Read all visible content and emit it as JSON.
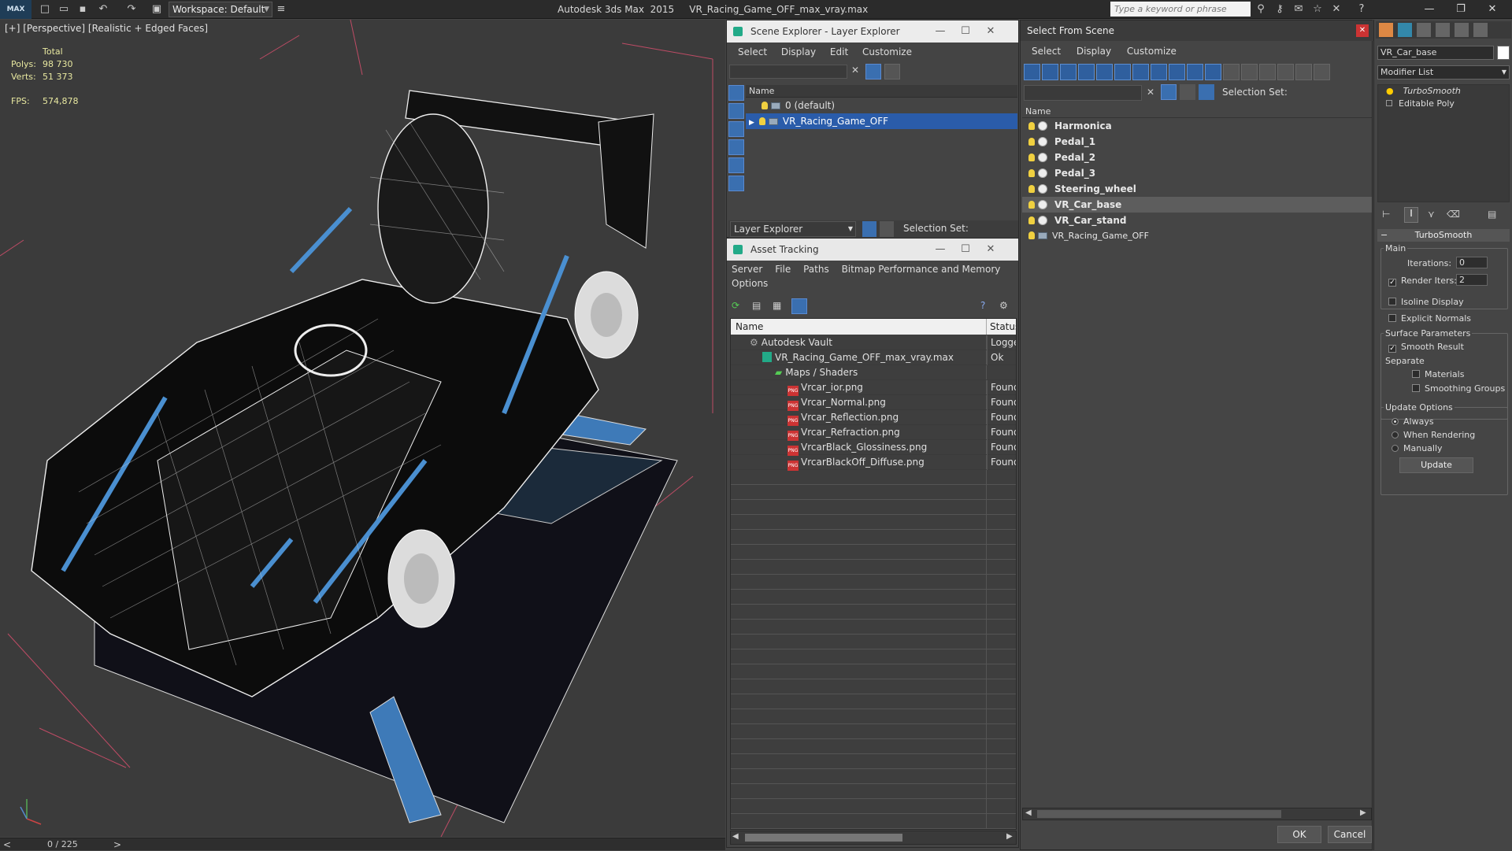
{
  "titlebar": {
    "logo": "MAX",
    "workspace": "Workspace: Default",
    "app_title": "Autodesk 3ds Max  2015     VR_Racing_Game_OFF_max_vray.max",
    "search_placeholder": "Type a keyword or phrase"
  },
  "viewport": {
    "label": "[+] [Perspective] [Realistic + Edged Faces]",
    "stats": {
      "total_label": "Total",
      "polys_label": "Polys:",
      "polys_value": "98 730",
      "verts_label": "Verts:",
      "verts_value": "51 373",
      "fps_label": "FPS:",
      "fps_value": "574,878"
    },
    "timeline": "0 / 225"
  },
  "scene_explorer": {
    "title": "Scene Explorer - Layer Explorer",
    "menu": [
      "Select",
      "Display",
      "Edit",
      "Customize"
    ],
    "column": "Name",
    "layers": [
      "0 (default)",
      "VR_Racing_Game_OFF"
    ],
    "footer_dropdown": "Layer Explorer",
    "footer_selection": "Selection Set:"
  },
  "asset_tracking": {
    "title": "Asset Tracking",
    "menu": [
      "Server",
      "File",
      "Paths",
      "Bitmap Performance and Memory"
    ],
    "menu2": "Options",
    "col_name": "Name",
    "col_status": "Status",
    "rows": [
      {
        "name": "Autodesk Vault",
        "status": "Logged"
      },
      {
        "name": "VR_Racing_Game_OFF_max_vray.max",
        "status": "Ok"
      },
      {
        "name": "Maps / Shaders",
        "status": ""
      },
      {
        "name": "Vrcar_ior.png",
        "status": "Found"
      },
      {
        "name": "Vrcar_Normal.png",
        "status": "Found"
      },
      {
        "name": "Vrcar_Reflection.png",
        "status": "Found"
      },
      {
        "name": "Vrcar_Refraction.png",
        "status": "Found"
      },
      {
        "name": "VrcarBlack_Glossiness.png",
        "status": "Found"
      },
      {
        "name": "VrcarBlackOff_Diffuse.png",
        "status": "Found"
      }
    ],
    "png_label": "PNG"
  },
  "select_from_scene": {
    "title": "Select From Scene",
    "menu": [
      "Select",
      "Display",
      "Customize"
    ],
    "selection_set": "Selection Set:",
    "column": "Name",
    "objects": [
      "Harmonica",
      "Pedal_1",
      "Pedal_2",
      "Pedal_3",
      "Steering_wheel",
      "VR_Car_base",
      "VR_Car_stand",
      "VR_Racing_Game_OFF"
    ],
    "ok": "OK",
    "cancel": "Cancel"
  },
  "command_panel": {
    "object_name": "VR_Car_base",
    "modifier_list": "Modifier List",
    "stack": [
      "TurboSmooth",
      "Editable Poly"
    ],
    "rollout": "TurboSmooth",
    "main": "Main",
    "iterations_label": "Iterations:",
    "iterations_value": "0",
    "render_iters_label": "Render Iters:",
    "render_iters_value": "2",
    "isoline": "Isoline Display",
    "explicit": "Explicit Normals",
    "surface": "Surface Parameters",
    "smooth": "Smooth Result",
    "separate": "Separate",
    "materials": "Materials",
    "smoothing_groups": "Smoothing Groups",
    "update_options": "Update Options",
    "always": "Always",
    "when_rendering": "When Rendering",
    "manually": "Manually",
    "update_btn": "Update"
  }
}
